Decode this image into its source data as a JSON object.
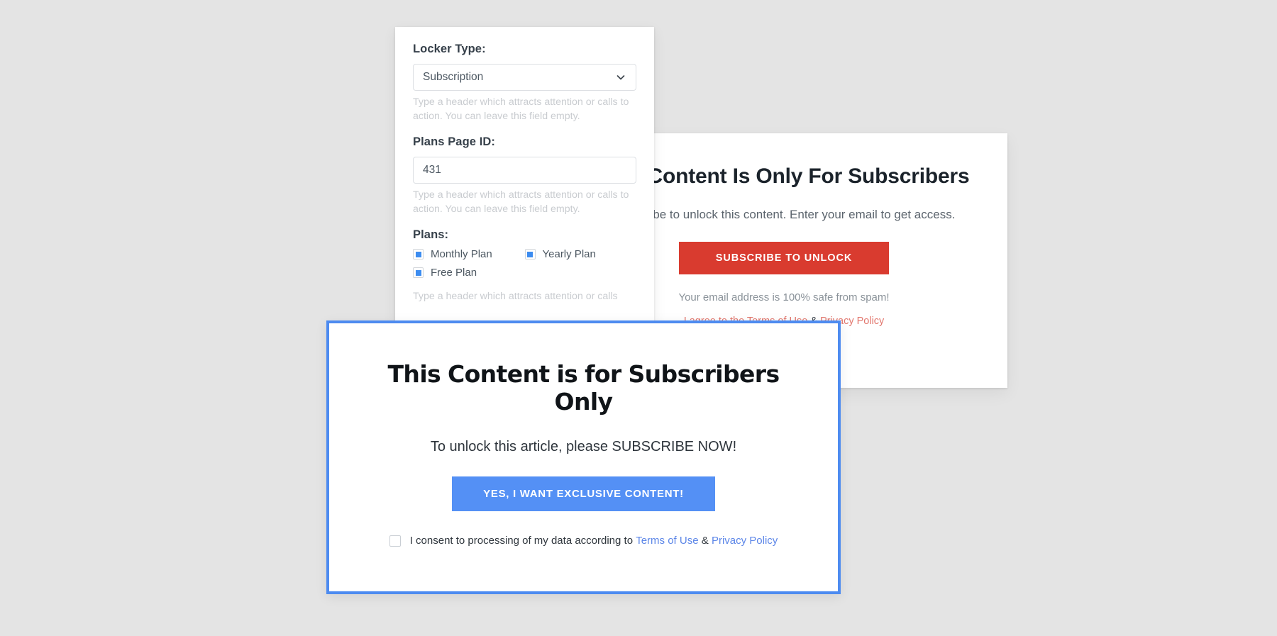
{
  "background_color": "#e4e4e4",
  "settings_panel": {
    "locker_type": {
      "label": "Locker Type:",
      "value": "Subscription",
      "chevron_icon": "chevron-down-icon",
      "help": "Type a header which attracts attention or calls to action. You can leave this field empty."
    },
    "plans_page_id": {
      "label": "Plans Page ID:",
      "value": "431",
      "placeholder": "",
      "help": "Type a header which attracts attention or calls to action. You can leave this field empty."
    },
    "plans": {
      "label": "Plans:",
      "items": [
        {
          "label": "Monthly Plan",
          "checked": true
        },
        {
          "label": "Yearly Plan",
          "checked": true
        },
        {
          "label": "Free Plan",
          "checked": true
        }
      ],
      "help": "Type a header which attracts attention or calls"
    }
  },
  "red_card": {
    "title": "This Content Is Only For Subscribers",
    "subtitle": "Subscribe to unlock this content. Enter your email to get access.",
    "button_label": "SUBSCRIBE TO UNLOCK",
    "safety_note": "Your email address is 100% safe from spam!",
    "terms_prefix": "I agree to the ",
    "terms_link": "Terms of Use",
    "terms_amp": " & ",
    "privacy_link": "Privacy Policy",
    "accent_color": "#d93b2f",
    "link_color": "#e2776e"
  },
  "blue_modal": {
    "title": "This Content is for Subscribers Only",
    "subtitle": "To unlock this article, please SUBSCRIBE NOW!",
    "button_label": "YES, I WANT EXCLUSIVE CONTENT!",
    "consent_text": "I consent to processing of my data according to",
    "terms_link": "Terms of Use",
    "consent_amp": "&",
    "privacy_link": "Privacy Policy",
    "consent_checked": false,
    "border_color": "#4d8bf0",
    "button_color": "#5490f5",
    "link_color": "#5c86e8"
  }
}
